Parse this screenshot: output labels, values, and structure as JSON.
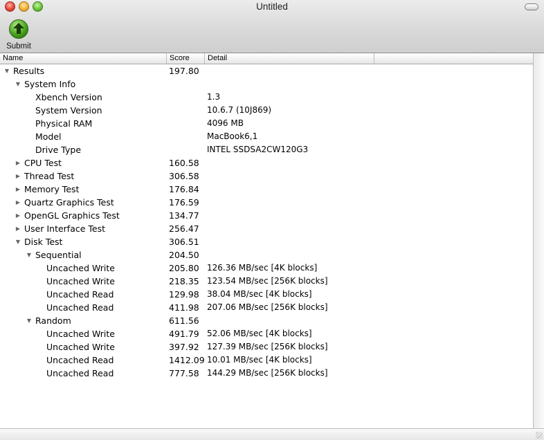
{
  "window": {
    "title": "Untitled"
  },
  "toolbar": {
    "submit_label": "Submit"
  },
  "columns": {
    "name": "Name",
    "score": "Score",
    "detail": "Detail"
  },
  "rows": [
    {
      "name": "Results",
      "score": "197.80",
      "detail": "",
      "level": 0,
      "tri": "down"
    },
    {
      "name": "System Info",
      "score": "",
      "detail": "",
      "level": 1,
      "tri": "down"
    },
    {
      "name": "Xbench Version",
      "score": "",
      "detail": "1.3",
      "level": 2,
      "tri": ""
    },
    {
      "name": "System Version",
      "score": "",
      "detail": "10.6.7 (10J869)",
      "level": 2,
      "tri": ""
    },
    {
      "name": "Physical RAM",
      "score": "",
      "detail": "4096 MB",
      "level": 2,
      "tri": ""
    },
    {
      "name": "Model",
      "score": "",
      "detail": "MacBook6,1",
      "level": 2,
      "tri": ""
    },
    {
      "name": "Drive Type",
      "score": "",
      "detail": "INTEL SSDSA2CW120G3",
      "level": 2,
      "tri": ""
    },
    {
      "name": "CPU Test",
      "score": "160.58",
      "detail": "",
      "level": 1,
      "tri": "right"
    },
    {
      "name": "Thread Test",
      "score": "306.58",
      "detail": "",
      "level": 1,
      "tri": "right"
    },
    {
      "name": "Memory Test",
      "score": "176.84",
      "detail": "",
      "level": 1,
      "tri": "right"
    },
    {
      "name": "Quartz Graphics Test",
      "score": "176.59",
      "detail": "",
      "level": 1,
      "tri": "right"
    },
    {
      "name": "OpenGL Graphics Test",
      "score": "134.77",
      "detail": "",
      "level": 1,
      "tri": "right"
    },
    {
      "name": "User Interface Test",
      "score": "256.47",
      "detail": "",
      "level": 1,
      "tri": "right"
    },
    {
      "name": "Disk Test",
      "score": "306.51",
      "detail": "",
      "level": 1,
      "tri": "down"
    },
    {
      "name": "Sequential",
      "score": "204.50",
      "detail": "",
      "level": 2,
      "tri": "down"
    },
    {
      "name": "Uncached Write",
      "score": "205.80",
      "detail": "126.36 MB/sec [4K blocks]",
      "level": 3,
      "tri": ""
    },
    {
      "name": "Uncached Write",
      "score": "218.35",
      "detail": "123.54 MB/sec [256K blocks]",
      "level": 3,
      "tri": ""
    },
    {
      "name": "Uncached Read",
      "score": "129.98",
      "detail": "38.04 MB/sec [4K blocks]",
      "level": 3,
      "tri": ""
    },
    {
      "name": "Uncached Read",
      "score": "411.98",
      "detail": "207.06 MB/sec [256K blocks]",
      "level": 3,
      "tri": ""
    },
    {
      "name": "Random",
      "score": "611.56",
      "detail": "",
      "level": 2,
      "tri": "down"
    },
    {
      "name": "Uncached Write",
      "score": "491.79",
      "detail": "52.06 MB/sec [4K blocks]",
      "level": 3,
      "tri": ""
    },
    {
      "name": "Uncached Write",
      "score": "397.92",
      "detail": "127.39 MB/sec [256K blocks]",
      "level": 3,
      "tri": ""
    },
    {
      "name": "Uncached Read",
      "score": "1412.09",
      "detail": "10.01 MB/sec [4K blocks]",
      "level": 3,
      "tri": ""
    },
    {
      "name": "Uncached Read",
      "score": "777.58",
      "detail": "144.29 MB/sec [256K blocks]",
      "level": 3,
      "tri": ""
    }
  ]
}
